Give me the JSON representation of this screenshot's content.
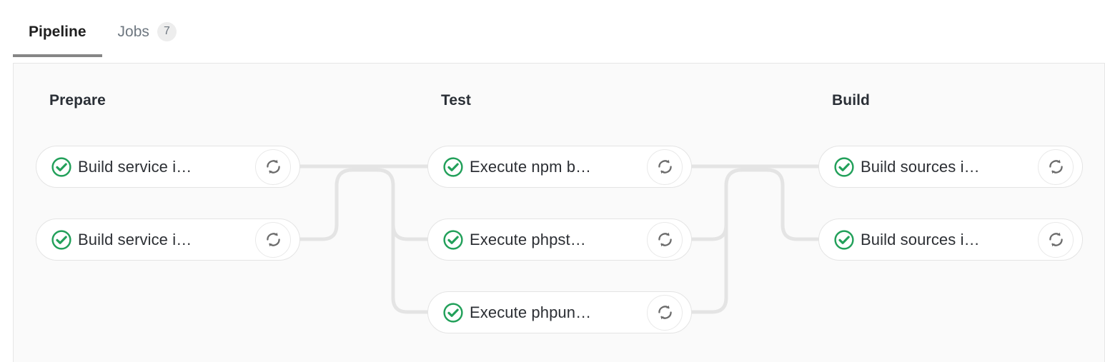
{
  "tabs": [
    {
      "label": "Pipeline",
      "active": true,
      "badge": null
    },
    {
      "label": "Jobs",
      "active": false,
      "badge": "7"
    }
  ],
  "pipeline": {
    "stages": [
      {
        "name": "Prepare",
        "jobs": [
          {
            "label": "Build service i…",
            "status": "success",
            "action": "retry"
          },
          {
            "label": "Build service i…",
            "status": "success",
            "action": "retry"
          }
        ]
      },
      {
        "name": "Test",
        "jobs": [
          {
            "label": "Execute npm b…",
            "status": "success",
            "action": "retry"
          },
          {
            "label": "Execute phpst…",
            "status": "success",
            "action": "retry"
          },
          {
            "label": "Execute phpun…",
            "status": "success",
            "action": "retry"
          }
        ]
      },
      {
        "name": "Build",
        "jobs": [
          {
            "label": "Build sources i…",
            "status": "success",
            "action": "retry"
          },
          {
            "label": "Build sources i…",
            "status": "success",
            "action": "retry"
          }
        ]
      }
    ]
  },
  "icons": {
    "status_success": "check-circle-icon",
    "retry": "retry-icon"
  },
  "colors": {
    "success_green": "#22a05a",
    "connector_gray": "#e4e4e4",
    "panel_background": "#fafafa",
    "tab_active_underline": "#868686",
    "tab_inactive_text": "#6e7780",
    "badge_background": "#ededed"
  }
}
